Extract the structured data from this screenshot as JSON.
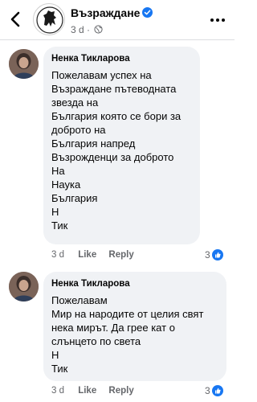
{
  "header": {
    "page_name": "Възраждане",
    "time": "3 d",
    "separator": "·",
    "icons": [
      "back-icon",
      "page-logo",
      "verified-icon",
      "globe-icon",
      "more-options-icon"
    ]
  },
  "comments": [
    {
      "author": "Ненка Тикларова",
      "lines": [
        "Пожелавам успех на",
        "Възраждане пътеводната",
        "звезда на",
        "България която се бори за",
        "доброто на",
        "България напред",
        "Възрожденци за доброто",
        "На",
        "Наука",
        "България",
        "Н",
        "Тик"
      ],
      "time": "3 d",
      "like_label": "Like",
      "reply_label": "Reply",
      "reaction_count": "3"
    },
    {
      "author": "Ненка Тикларова",
      "lines": [
        "Пожелавам",
        "Мир на народите от целия свят",
        "нека мирът. Да грее кат о",
        "слънцето по света",
        "Н",
        "Тик"
      ],
      "time": "3 d",
      "like_label": "Like",
      "reply_label": "Reply",
      "reaction_count": "3"
    }
  ],
  "colors": {
    "bubble": "#f0f2f5",
    "secondary_text": "#65676b",
    "accent": "#1877f2"
  }
}
